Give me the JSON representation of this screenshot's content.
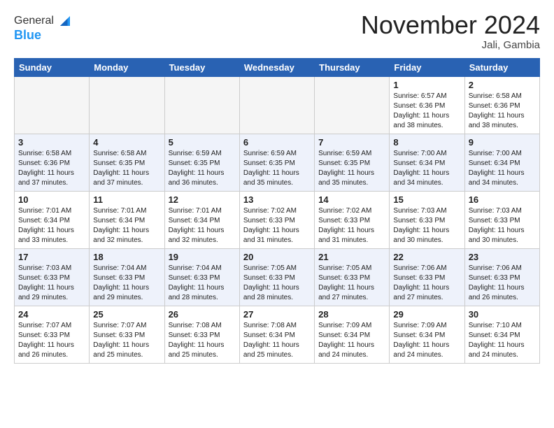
{
  "header": {
    "logo_general": "General",
    "logo_blue": "Blue",
    "month_title": "November 2024",
    "location": "Jali, Gambia"
  },
  "calendar": {
    "days_of_week": [
      "Sunday",
      "Monday",
      "Tuesday",
      "Wednesday",
      "Thursday",
      "Friday",
      "Saturday"
    ],
    "weeks": [
      [
        {
          "day": "",
          "info": ""
        },
        {
          "day": "",
          "info": ""
        },
        {
          "day": "",
          "info": ""
        },
        {
          "day": "",
          "info": ""
        },
        {
          "day": "",
          "info": ""
        },
        {
          "day": "1",
          "info": "Sunrise: 6:57 AM\nSunset: 6:36 PM\nDaylight: 11 hours\nand 38 minutes."
        },
        {
          "day": "2",
          "info": "Sunrise: 6:58 AM\nSunset: 6:36 PM\nDaylight: 11 hours\nand 38 minutes."
        }
      ],
      [
        {
          "day": "3",
          "info": "Sunrise: 6:58 AM\nSunset: 6:36 PM\nDaylight: 11 hours\nand 37 minutes."
        },
        {
          "day": "4",
          "info": "Sunrise: 6:58 AM\nSunset: 6:35 PM\nDaylight: 11 hours\nand 37 minutes."
        },
        {
          "day": "5",
          "info": "Sunrise: 6:59 AM\nSunset: 6:35 PM\nDaylight: 11 hours\nand 36 minutes."
        },
        {
          "day": "6",
          "info": "Sunrise: 6:59 AM\nSunset: 6:35 PM\nDaylight: 11 hours\nand 35 minutes."
        },
        {
          "day": "7",
          "info": "Sunrise: 6:59 AM\nSunset: 6:35 PM\nDaylight: 11 hours\nand 35 minutes."
        },
        {
          "day": "8",
          "info": "Sunrise: 7:00 AM\nSunset: 6:34 PM\nDaylight: 11 hours\nand 34 minutes."
        },
        {
          "day": "9",
          "info": "Sunrise: 7:00 AM\nSunset: 6:34 PM\nDaylight: 11 hours\nand 34 minutes."
        }
      ],
      [
        {
          "day": "10",
          "info": "Sunrise: 7:01 AM\nSunset: 6:34 PM\nDaylight: 11 hours\nand 33 minutes."
        },
        {
          "day": "11",
          "info": "Sunrise: 7:01 AM\nSunset: 6:34 PM\nDaylight: 11 hours\nand 32 minutes."
        },
        {
          "day": "12",
          "info": "Sunrise: 7:01 AM\nSunset: 6:34 PM\nDaylight: 11 hours\nand 32 minutes."
        },
        {
          "day": "13",
          "info": "Sunrise: 7:02 AM\nSunset: 6:33 PM\nDaylight: 11 hours\nand 31 minutes."
        },
        {
          "day": "14",
          "info": "Sunrise: 7:02 AM\nSunset: 6:33 PM\nDaylight: 11 hours\nand 31 minutes."
        },
        {
          "day": "15",
          "info": "Sunrise: 7:03 AM\nSunset: 6:33 PM\nDaylight: 11 hours\nand 30 minutes."
        },
        {
          "day": "16",
          "info": "Sunrise: 7:03 AM\nSunset: 6:33 PM\nDaylight: 11 hours\nand 30 minutes."
        }
      ],
      [
        {
          "day": "17",
          "info": "Sunrise: 7:03 AM\nSunset: 6:33 PM\nDaylight: 11 hours\nand 29 minutes."
        },
        {
          "day": "18",
          "info": "Sunrise: 7:04 AM\nSunset: 6:33 PM\nDaylight: 11 hours\nand 29 minutes."
        },
        {
          "day": "19",
          "info": "Sunrise: 7:04 AM\nSunset: 6:33 PM\nDaylight: 11 hours\nand 28 minutes."
        },
        {
          "day": "20",
          "info": "Sunrise: 7:05 AM\nSunset: 6:33 PM\nDaylight: 11 hours\nand 28 minutes."
        },
        {
          "day": "21",
          "info": "Sunrise: 7:05 AM\nSunset: 6:33 PM\nDaylight: 11 hours\nand 27 minutes."
        },
        {
          "day": "22",
          "info": "Sunrise: 7:06 AM\nSunset: 6:33 PM\nDaylight: 11 hours\nand 27 minutes."
        },
        {
          "day": "23",
          "info": "Sunrise: 7:06 AM\nSunset: 6:33 PM\nDaylight: 11 hours\nand 26 minutes."
        }
      ],
      [
        {
          "day": "24",
          "info": "Sunrise: 7:07 AM\nSunset: 6:33 PM\nDaylight: 11 hours\nand 26 minutes."
        },
        {
          "day": "25",
          "info": "Sunrise: 7:07 AM\nSunset: 6:33 PM\nDaylight: 11 hours\nand 25 minutes."
        },
        {
          "day": "26",
          "info": "Sunrise: 7:08 AM\nSunset: 6:33 PM\nDaylight: 11 hours\nand 25 minutes."
        },
        {
          "day": "27",
          "info": "Sunrise: 7:08 AM\nSunset: 6:34 PM\nDaylight: 11 hours\nand 25 minutes."
        },
        {
          "day": "28",
          "info": "Sunrise: 7:09 AM\nSunset: 6:34 PM\nDaylight: 11 hours\nand 24 minutes."
        },
        {
          "day": "29",
          "info": "Sunrise: 7:09 AM\nSunset: 6:34 PM\nDaylight: 11 hours\nand 24 minutes."
        },
        {
          "day": "30",
          "info": "Sunrise: 7:10 AM\nSunset: 6:34 PM\nDaylight: 11 hours\nand 24 minutes."
        }
      ]
    ]
  }
}
